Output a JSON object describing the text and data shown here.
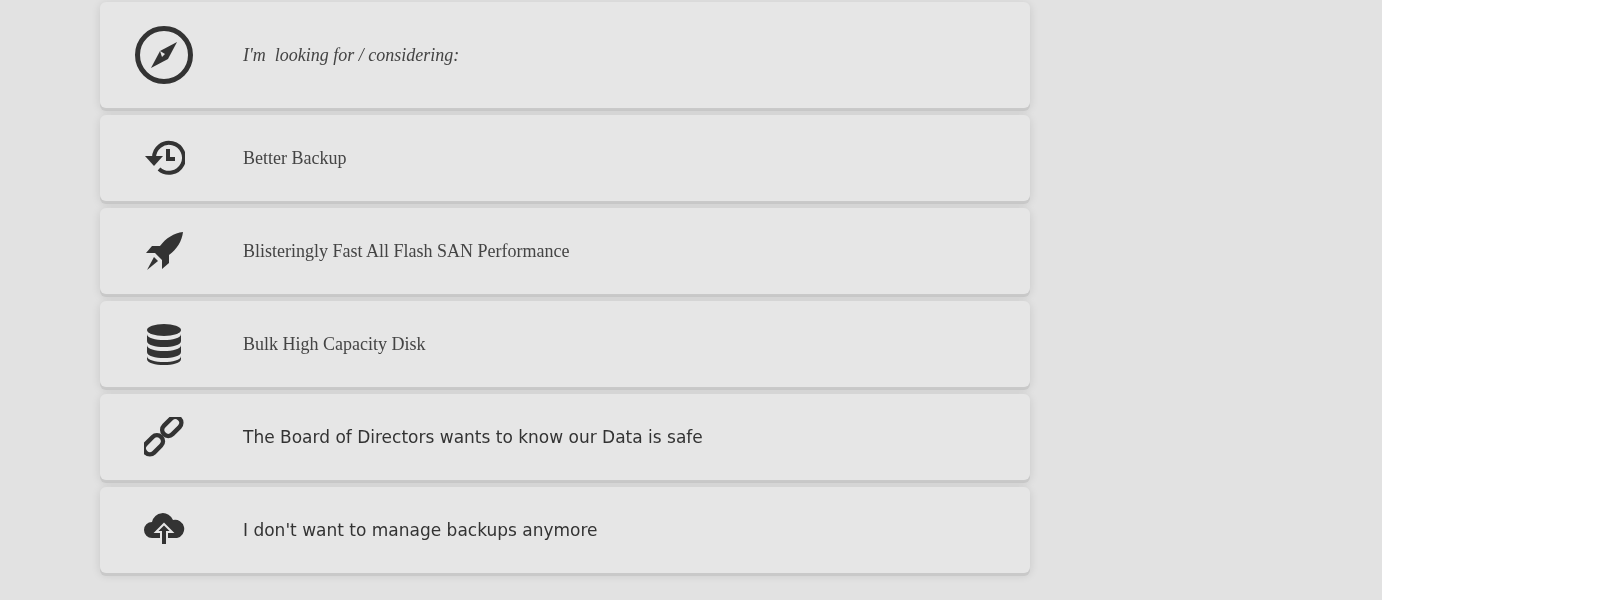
{
  "options": [
    {
      "kind": "header",
      "label": "I'm  looking for / considering:"
    },
    {
      "kind": "option",
      "label": "Better Backup"
    },
    {
      "kind": "option",
      "label": "Blisteringly Fast All Flash SAN Performance"
    },
    {
      "kind": "option",
      "label": "Bulk High Capacity Disk"
    },
    {
      "kind": "option",
      "label": "The Board of Directors wants to know our Data is safe"
    },
    {
      "kind": "option",
      "label": "I don't want to manage backups anymore"
    }
  ]
}
